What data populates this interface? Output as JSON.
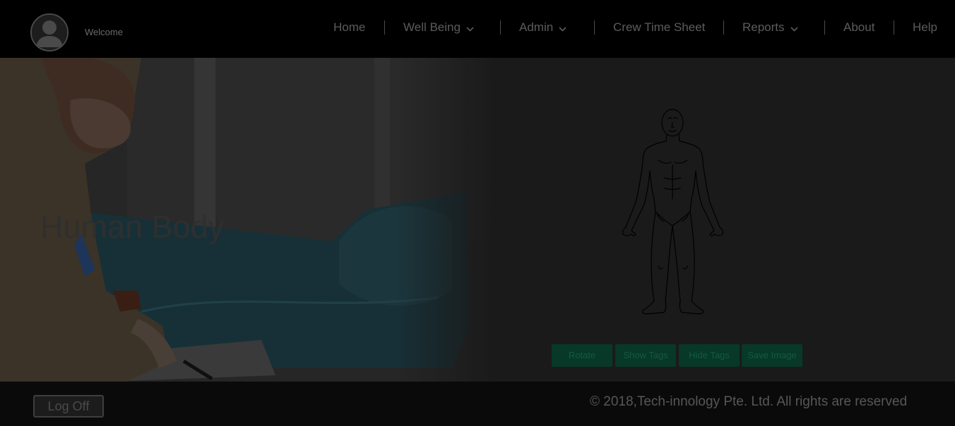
{
  "header": {
    "welcome": "Welcome",
    "avatar_icon": "user-avatar-icon",
    "nav": [
      {
        "label": "Home"
      },
      {
        "label": "Well Being",
        "icon": "chevron-down-icon"
      },
      {
        "label": "Admin",
        "icon": "chevron-down-icon"
      },
      {
        "label": "Crew Time Sheet"
      },
      {
        "label": "Reports",
        "icon": "chevron-down-icon"
      },
      {
        "label": "About"
      },
      {
        "label": "Help"
      }
    ]
  },
  "hero": {
    "title": "Human Body",
    "figure_icon": "human-body-outline",
    "buttons": [
      {
        "label": "Rotate"
      },
      {
        "label": "Show Tags"
      },
      {
        "label": "Hide Tags"
      },
      {
        "label": "Save Image"
      }
    ]
  },
  "footer": {
    "logoff": "Log Off",
    "copyright": "© 2018,Tech-innology Pte. Ltd. All rights are reserved"
  },
  "colors": {
    "button_bg": "#073828",
    "button_text": "#125a43",
    "nav_text": "#5c5c5c"
  }
}
